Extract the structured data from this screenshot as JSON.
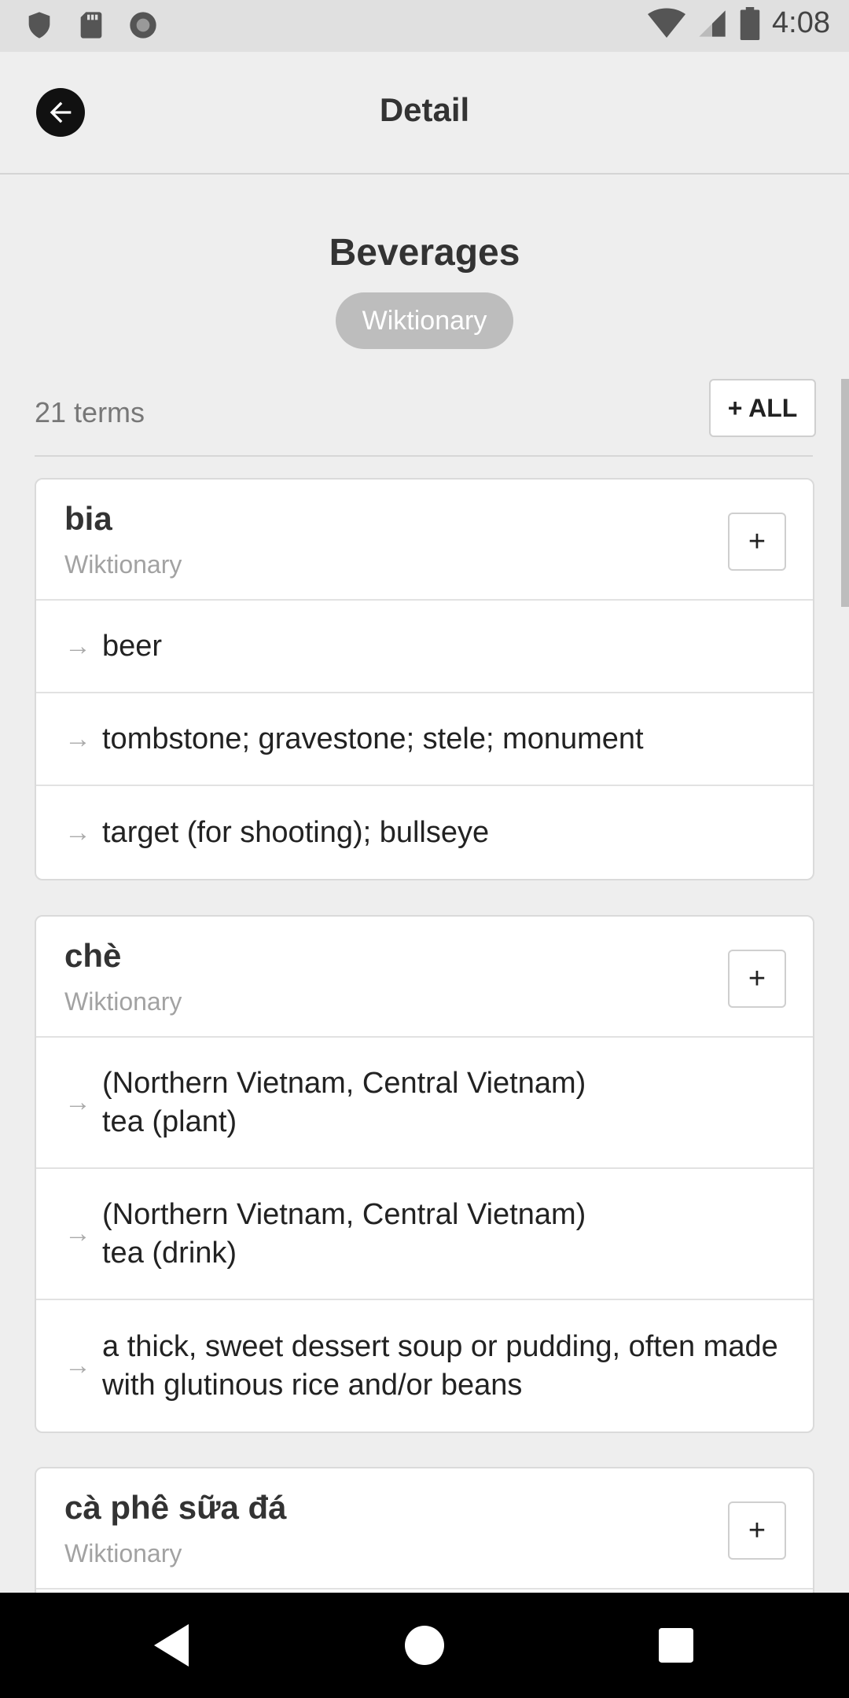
{
  "status_bar": {
    "time": "4:08",
    "left_icons": [
      "shield-icon",
      "sd-card-icon",
      "circle-icon"
    ],
    "right_icons": [
      "wifi-icon",
      "signal-icon",
      "battery-icon"
    ]
  },
  "app_bar": {
    "title": "Detail",
    "back_icon": "arrow-left-icon"
  },
  "list": {
    "title": "Beverages",
    "source_chip": "Wiktionary",
    "term_count": "21 terms",
    "add_all_label": "+ ALL"
  },
  "cards": [
    {
      "term": "bia",
      "source": "Wiktionary",
      "add_label": "+",
      "definitions": [
        "beer",
        "tombstone; gravestone; stele; monument",
        "target (for shooting); bullseye"
      ]
    },
    {
      "term": "chè",
      "source": "Wiktionary",
      "add_label": "+",
      "definitions": [
        "(Northern Vietnam, Central Vietnam)\ntea (plant)",
        "(Northern Vietnam, Central Vietnam)\ntea (drink)",
        "a thick, sweet dessert soup or pudding, often made with glutinous rice and/or beans"
      ]
    },
    {
      "term": "cà phê sữa đá",
      "source": "Wiktionary",
      "add_label": "+"
    }
  ],
  "definition_arrow": "→",
  "colors": {
    "background": "#eeeeee",
    "chip": "#bdbdbd",
    "card": "#ffffff",
    "nav_bar": "#000000"
  }
}
